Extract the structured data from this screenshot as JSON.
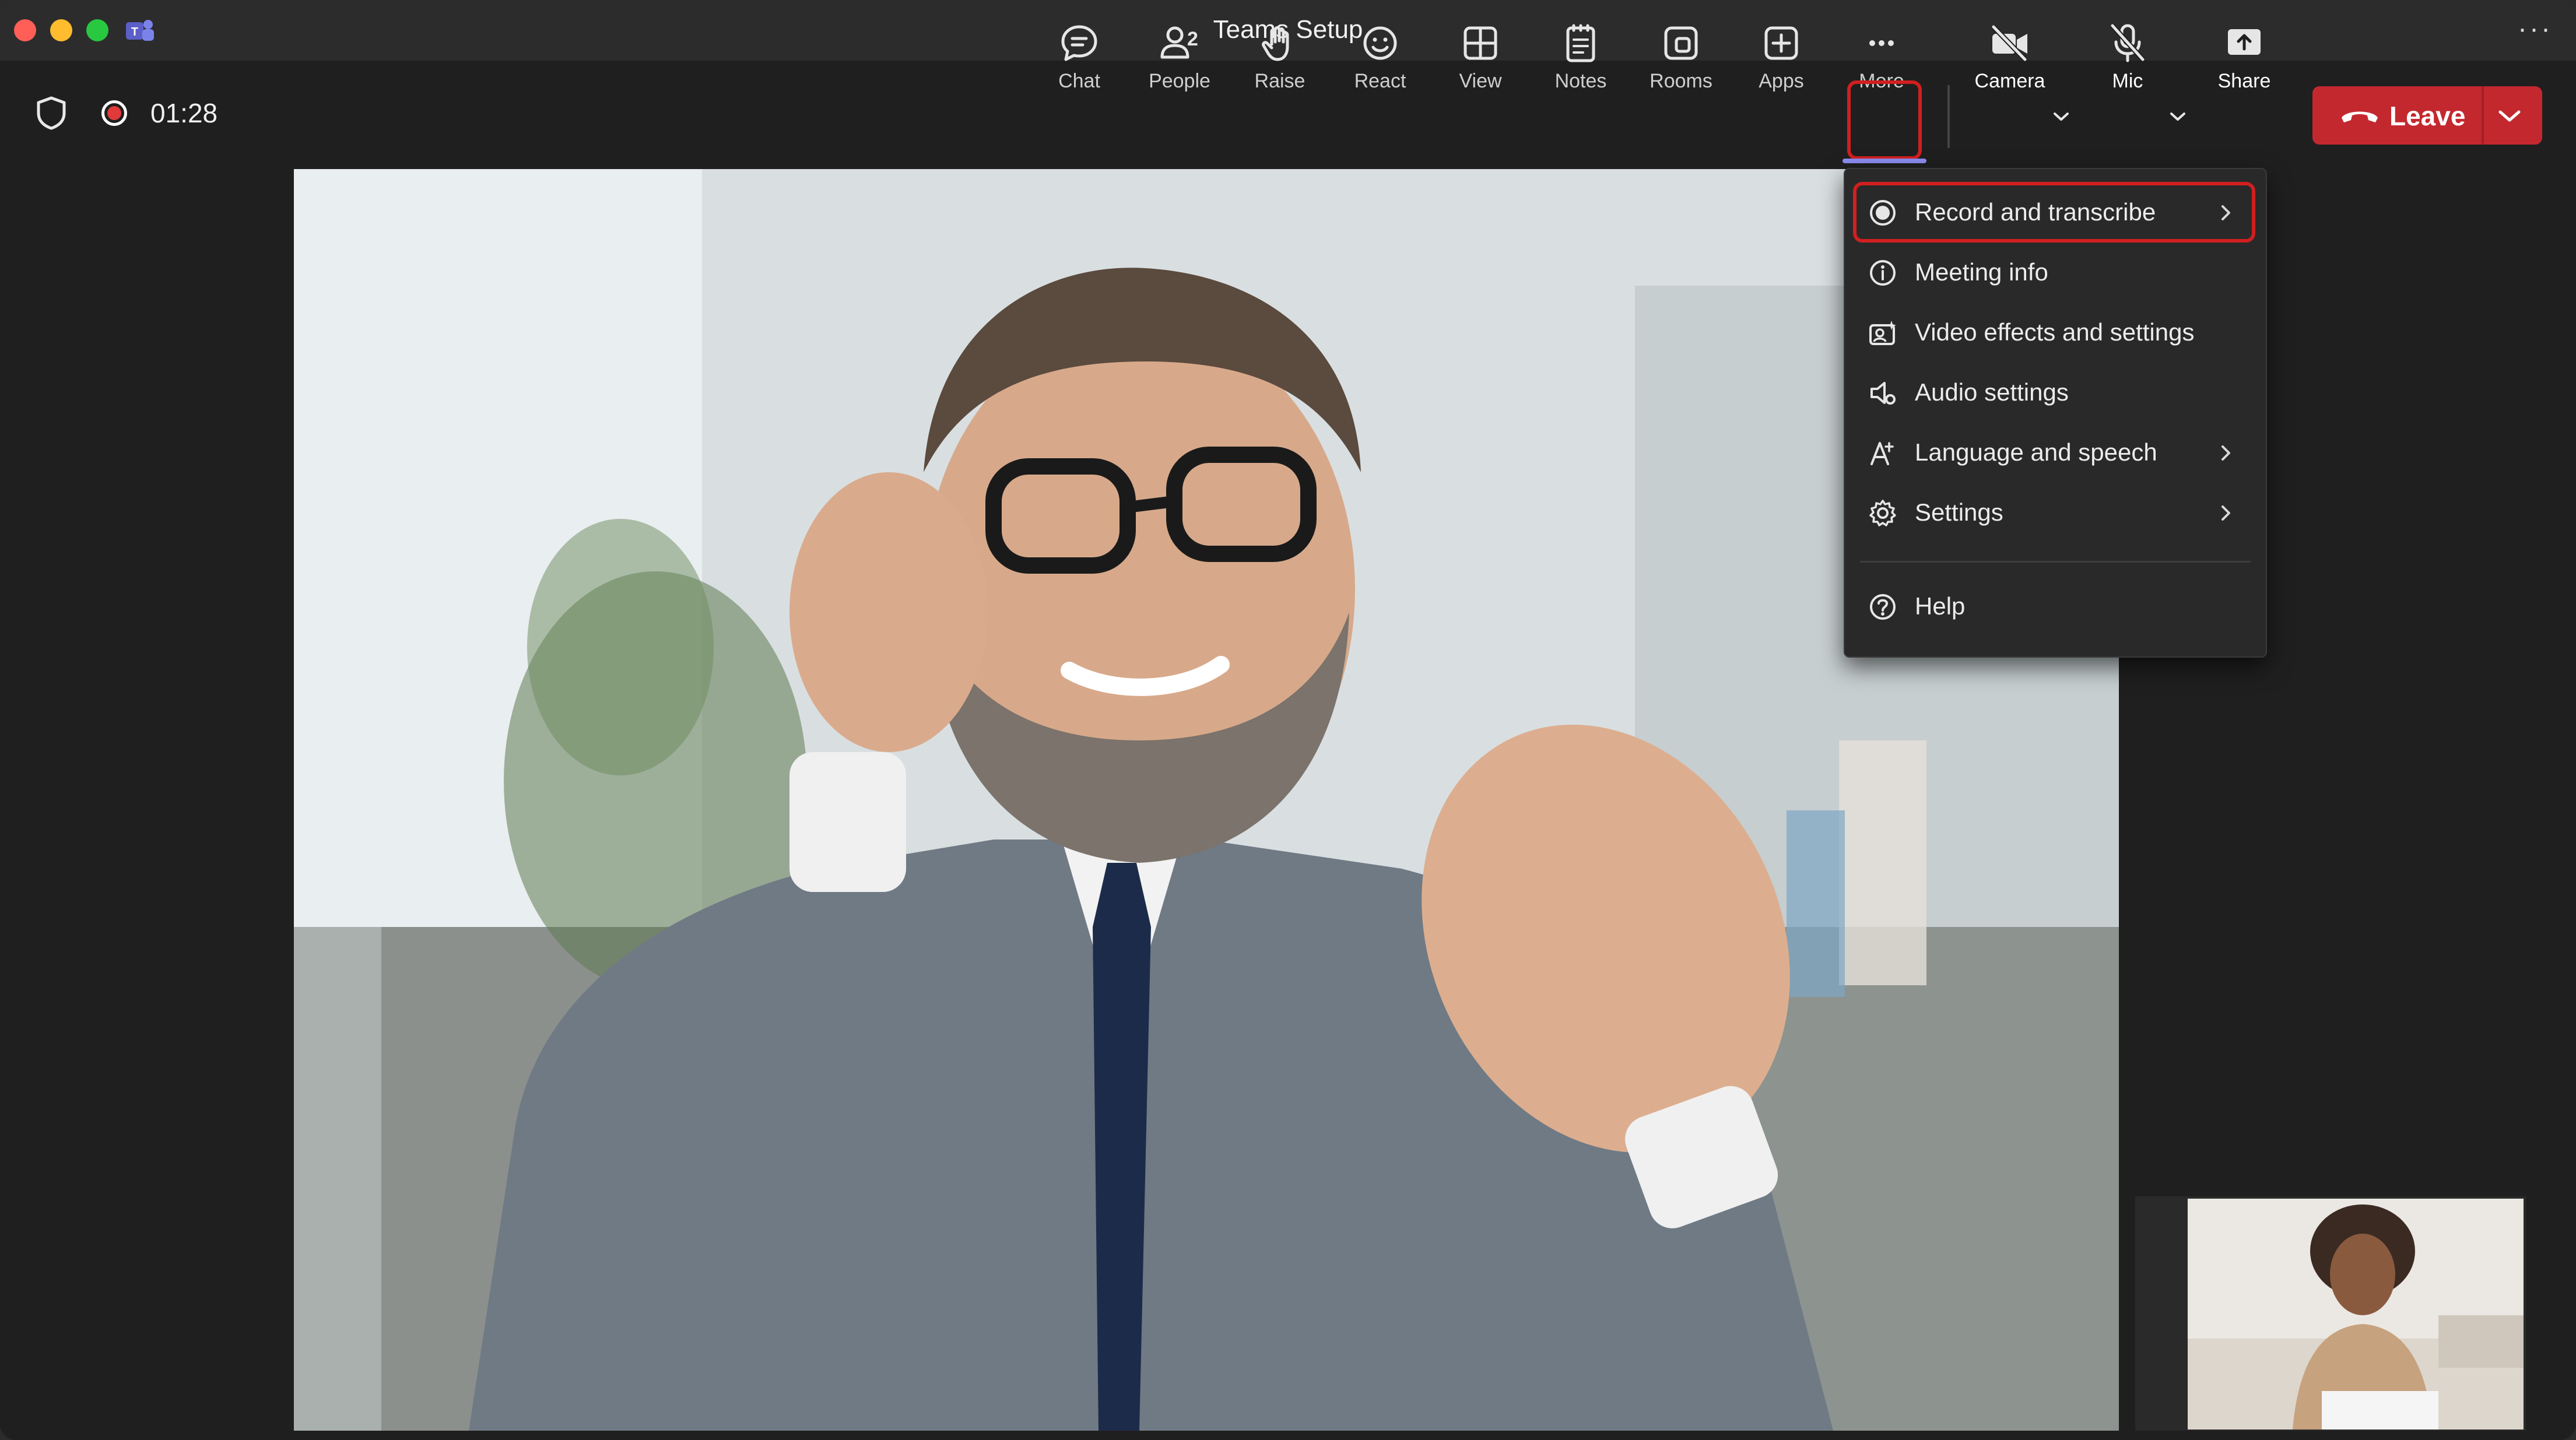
{
  "window": {
    "title": "Teams Setup"
  },
  "meeting": {
    "elapsed": "01:28"
  },
  "toolbar": {
    "buttons": [
      {
        "id": "chat",
        "label": "Chat",
        "icon": "chat-bubble-icon"
      },
      {
        "id": "people",
        "label": "People",
        "icon": "people-icon",
        "badge": "2"
      },
      {
        "id": "raise",
        "label": "Raise",
        "icon": "raise-hand-icon"
      },
      {
        "id": "react",
        "label": "React",
        "icon": "smiley-icon"
      },
      {
        "id": "view",
        "label": "View",
        "icon": "grid-view-icon"
      },
      {
        "id": "notes",
        "label": "Notes",
        "icon": "notes-icon"
      },
      {
        "id": "rooms",
        "label": "Rooms",
        "icon": "rooms-icon"
      },
      {
        "id": "apps",
        "label": "Apps",
        "icon": "add-app-icon"
      },
      {
        "id": "more",
        "label": "More",
        "icon": "ellipsis-icon",
        "active": true
      },
      {
        "id": "camera",
        "label": "Camera",
        "icon": "camera-off-icon"
      },
      {
        "id": "mic",
        "label": "Mic",
        "icon": "mic-off-icon"
      },
      {
        "id": "share",
        "label": "Share",
        "icon": "share-upload-icon"
      }
    ],
    "leave_label": "Leave"
  },
  "more_menu": {
    "items": [
      {
        "label": "Record and transcribe",
        "icon": "record-icon",
        "submenu": true,
        "highlighted": true
      },
      {
        "label": "Meeting info",
        "icon": "info-icon",
        "submenu": false
      },
      {
        "label": "Video effects and settings",
        "icon": "video-effects-icon",
        "submenu": false
      },
      {
        "label": "Audio settings",
        "icon": "audio-settings-icon",
        "submenu": false
      },
      {
        "label": "Language and speech",
        "icon": "language-speech-icon",
        "submenu": true
      },
      {
        "label": "Settings",
        "icon": "gear-icon",
        "submenu": true
      }
    ],
    "help_label": "Help"
  },
  "colors": {
    "leave": "#c4282f",
    "highlight": "#d11f1f",
    "active_underline": "#8b8cf0",
    "recording": "#e03a3a"
  }
}
